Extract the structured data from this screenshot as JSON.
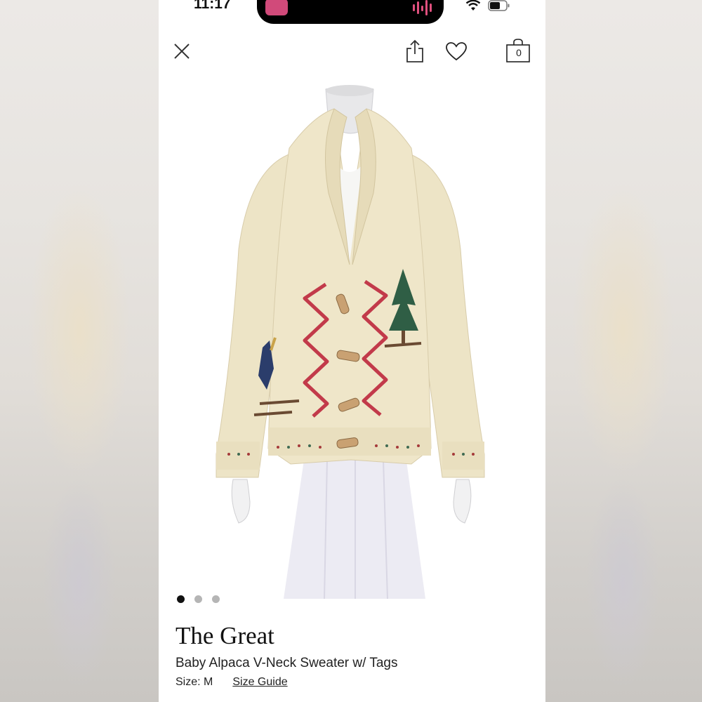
{
  "status_bar": {
    "time": "11:17"
  },
  "nav": {
    "close_icon": "close-icon",
    "share_icon": "share-icon",
    "favorite_icon": "heart-icon",
    "bag_icon": "shopping-bag-icon",
    "bag_count": "0"
  },
  "carousel": {
    "total": 3,
    "active_index": 0
  },
  "product": {
    "brand": "The Great",
    "name": "Baby Alpaca V-Neck Sweater w/ Tags",
    "size_label": "Size: M",
    "size_guide_link": "Size Guide"
  },
  "colors": {
    "sweater": "#ede4c6",
    "accent_red": "#c23a4a",
    "tree_green": "#2f5e45",
    "text": "#111111"
  }
}
